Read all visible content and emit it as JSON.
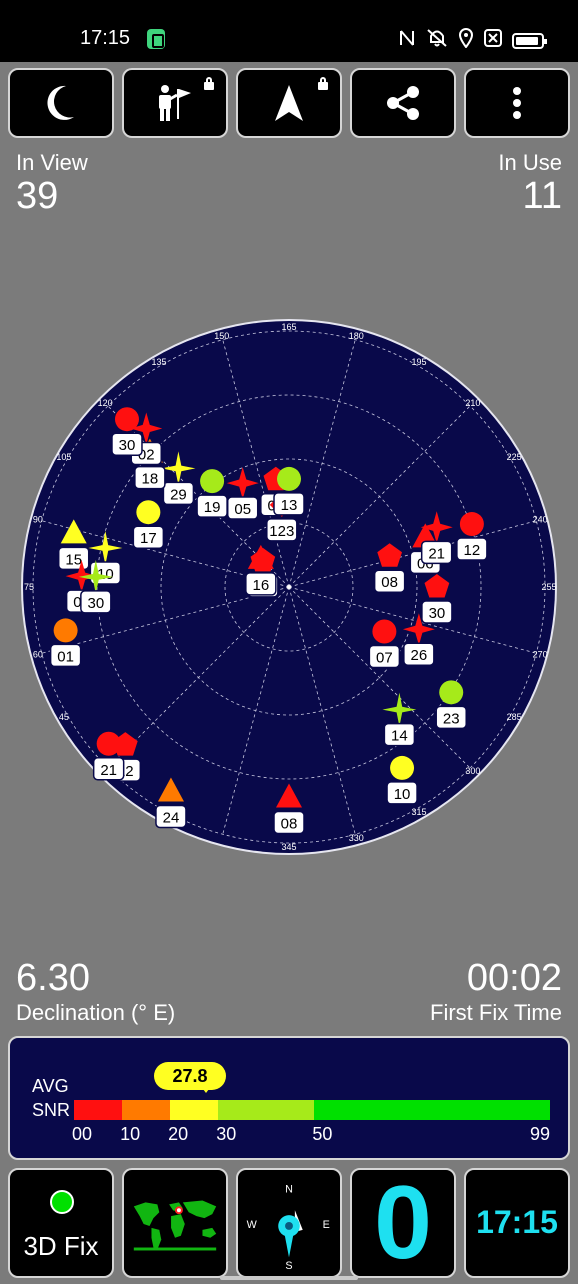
{
  "status_bar": {
    "time": "17:15"
  },
  "toolbar": {
    "buttons": [
      {
        "name": "night-mode-button",
        "icon": "moon-icon",
        "locked": false
      },
      {
        "name": "waypoint-button",
        "icon": "person-flag-icon",
        "locked": true
      },
      {
        "name": "navigation-button",
        "icon": "navigation-arrow-icon",
        "locked": true
      },
      {
        "name": "share-button",
        "icon": "share-icon",
        "locked": false
      },
      {
        "name": "more-button",
        "icon": "more-vertical-icon",
        "locked": false
      }
    ]
  },
  "stats": {
    "in_view_label": "In View",
    "in_view_value": "39",
    "in_use_label": "In Use",
    "in_use_value": "11",
    "declination_value": "6.30",
    "declination_label": "Declination (° E)",
    "first_fix_value": "00:02",
    "first_fix_label": "First Fix Time"
  },
  "sky": {
    "degree_labels": [
      "165",
      "180",
      "195",
      "210",
      "225",
      "240",
      "255",
      "270",
      "285",
      "300",
      "315",
      "330",
      "345",
      "30",
      "45",
      "60",
      "75",
      "90",
      "105",
      "120",
      "135",
      "150"
    ],
    "colors": {
      "red": "#ff1010",
      "orange": "#ff7a00",
      "yellow": "#ffff22",
      "lime": "#a6ea1a",
      "bg": "#09094a"
    },
    "satellites": [
      {
        "id": "03",
        "shape": "pentagon",
        "color": "red",
        "elev": 52,
        "az": 158
      },
      {
        "id": "123",
        "shape": "diamond",
        "color": "red",
        "elev": 61,
        "az": 160
      },
      {
        "id": "13",
        "shape": "circle",
        "color": "lime",
        "elev": 52,
        "az": 165
      },
      {
        "id": "05",
        "shape": "star",
        "color": "red",
        "elev": 50,
        "az": 141
      },
      {
        "id": "19",
        "shape": "circle",
        "color": "lime",
        "elev": 44,
        "az": 129
      },
      {
        "id": "29",
        "shape": "sparkle",
        "color": "yellow",
        "elev": 33,
        "az": 122
      },
      {
        "id": "18",
        "shape": "triangle",
        "color": "orange",
        "elev": 22,
        "az": 119
      },
      {
        "id": "02",
        "shape": "star",
        "color": "red",
        "elev": 15,
        "az": 123
      },
      {
        "id": "30",
        "shape": "circle",
        "color": "red",
        "elev": 8,
        "az": 121
      },
      {
        "id": "17",
        "shape": "circle",
        "color": "yellow",
        "elev": 34,
        "az": 103
      },
      {
        "id": "15",
        "shape": "triangle",
        "color": "yellow",
        "elev": 12,
        "az": 89
      },
      {
        "id": "10",
        "shape": "sparkle",
        "color": "yellow",
        "elev": 24,
        "az": 87
      },
      {
        "id": "07",
        "shape": "star",
        "color": "red",
        "elev": 17,
        "az": 78
      },
      {
        "id": "30",
        "shape": "sparkle",
        "color": "lime",
        "elev": 22,
        "az": 78
      },
      {
        "id": "01",
        "shape": "circle",
        "color": "orange",
        "elev": 10,
        "az": 64
      },
      {
        "id": "02",
        "shape": "pentagon",
        "color": "red",
        "elev": 77,
        "az": 120
      },
      {
        "id": "16",
        "shape": "triangle",
        "color": "red",
        "elev": 76,
        "az": 120
      },
      {
        "id": "08",
        "shape": "pentagon",
        "color": "red",
        "elev": 53,
        "az": 238
      },
      {
        "id": "06",
        "shape": "triangle",
        "color": "red",
        "elev": 39,
        "az": 235
      },
      {
        "id": "21",
        "shape": "star",
        "color": "red",
        "elev": 34,
        "az": 233
      },
      {
        "id": "12",
        "shape": "circle",
        "color": "red",
        "elev": 22,
        "az": 236
      },
      {
        "id": "30",
        "shape": "pentagon",
        "color": "red",
        "elev": 38,
        "az": 255
      },
      {
        "id": "26",
        "shape": "star",
        "color": "red",
        "elev": 42,
        "az": 273
      },
      {
        "id": "07",
        "shape": "circle",
        "color": "red",
        "elev": 53,
        "az": 280
      },
      {
        "id": "23",
        "shape": "circle",
        "color": "lime",
        "elev": 22,
        "az": 288
      },
      {
        "id": "14",
        "shape": "sparkle",
        "color": "lime",
        "elev": 32,
        "az": 303
      },
      {
        "id": "10",
        "shape": "circle",
        "color": "yellow",
        "elev": 15,
        "az": 313
      },
      {
        "id": "08",
        "shape": "triangle",
        "color": "red",
        "elev": 16,
        "az": 345
      },
      {
        "id": "24",
        "shape": "triangle",
        "color": "orange",
        "elev": 7,
        "az": 15
      },
      {
        "id": "12",
        "shape": "pentagon",
        "color": "red",
        "elev": 10,
        "az": 31
      },
      {
        "id": "21",
        "shape": "circle",
        "color": "red",
        "elev": 6,
        "az": 34
      }
    ]
  },
  "snr": {
    "avg_label": "AVG",
    "snr_label": "SNR",
    "avg_value": "27.8",
    "avg_numeric": 27.8,
    "ticks": [
      "00",
      "10",
      "20",
      "30",
      "50",
      "99"
    ],
    "segments": [
      {
        "from": 0,
        "to": 10,
        "color": "#ff1010"
      },
      {
        "from": 10,
        "to": 20,
        "color": "#ff7a00"
      },
      {
        "from": 20,
        "to": 30,
        "color": "#ffff22"
      },
      {
        "from": 30,
        "to": 50,
        "color": "#a6ea1a"
      },
      {
        "from": 50,
        "to": 99,
        "color": "#00e000"
      }
    ]
  },
  "bottom": {
    "fix_label": "3D Fix",
    "compass": {
      "n": "N",
      "s": "S",
      "e": "E",
      "w": "W"
    },
    "sats_used_big": "0",
    "clock": "17:15"
  }
}
